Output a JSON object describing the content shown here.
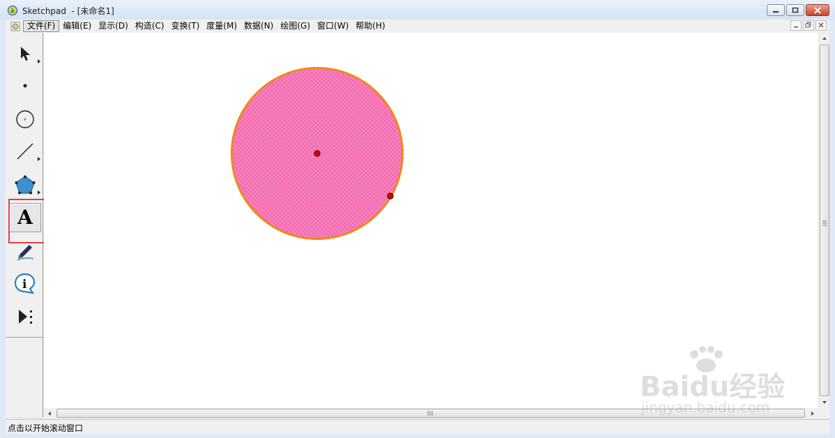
{
  "window": {
    "title": "Sketchpad  - [未命名1]",
    "app_icon": "sketchpad-app-icon"
  },
  "menubar": {
    "items": [
      {
        "label": "文件(F)",
        "active": true
      },
      {
        "label": "编辑(E)"
      },
      {
        "label": "显示(D)"
      },
      {
        "label": "构造(C)"
      },
      {
        "label": "变换(T)"
      },
      {
        "label": "度量(M)"
      },
      {
        "label": "数据(N)"
      },
      {
        "label": "绘图(G)"
      },
      {
        "label": "窗口(W)"
      },
      {
        "label": "帮助(H)"
      }
    ]
  },
  "toolbox": {
    "tools": [
      {
        "name": "selection-arrow-tool",
        "icon": "arrow-icon"
      },
      {
        "name": "point-tool",
        "icon": "point-icon"
      },
      {
        "name": "compass-tool",
        "icon": "circle-icon"
      },
      {
        "name": "straightedge-tool",
        "icon": "segment-icon"
      },
      {
        "name": "polygon-tool",
        "icon": "pentagon-icon"
      },
      {
        "name": "text-tool",
        "icon": "text-a-icon",
        "selected": true,
        "glyph": "A"
      },
      {
        "name": "marker-tool",
        "icon": "pen-icon"
      },
      {
        "name": "information-tool",
        "icon": "info-icon"
      },
      {
        "name": "custom-tool",
        "icon": "custom-tool-icon"
      }
    ]
  },
  "canvas": {
    "circle": {
      "fill": "#e8579a",
      "stroke": "#f0881a",
      "hatch": "#ff66cc"
    },
    "points_color": "#cc0000"
  },
  "statusbar": {
    "text": "点击以开始滚动窗口"
  },
  "watermark": {
    "logo": "Baidu经验",
    "url": "jingyan.baidu.com"
  },
  "colors": {
    "highlight": "#e0413f",
    "close_button": "#c7452b"
  }
}
